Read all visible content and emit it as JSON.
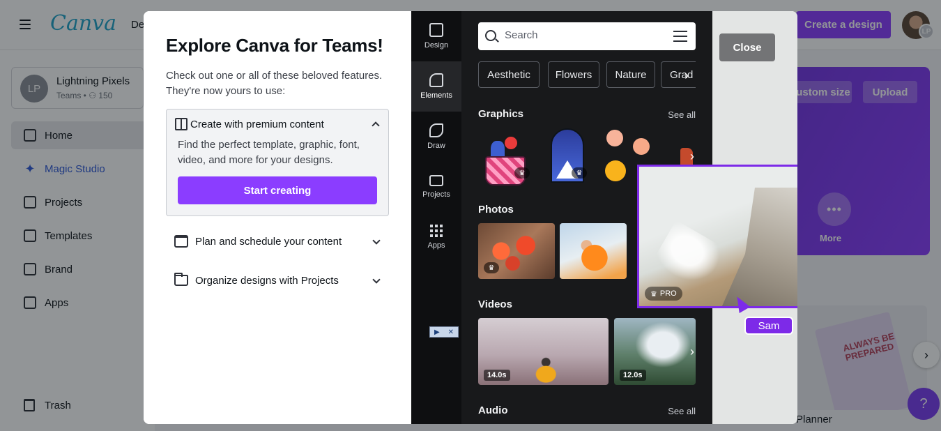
{
  "app": {
    "logo": "Canva",
    "nav_partial": "De",
    "create_button": "Create a design",
    "avatar_badge": "LP"
  },
  "sidebar": {
    "team_initials": "LP",
    "team_name": "Lightning Pixels",
    "team_sub": "Teams • ⚇ 150",
    "items": [
      {
        "label": "Home",
        "icon": "home-icon"
      },
      {
        "label": "Magic Studio",
        "icon": "sparkle-icon"
      },
      {
        "label": "Projects",
        "icon": "folder-icon"
      },
      {
        "label": "Templates",
        "icon": "templates-icon"
      },
      {
        "label": "Brand",
        "icon": "brand-icon"
      },
      {
        "label": "Apps",
        "icon": "apps-icon"
      }
    ],
    "trash": "Trash"
  },
  "hero": {
    "custom_size": "ustom size",
    "upload": "Upload",
    "more": "More"
  },
  "background": {
    "card_title": "ALWAYS BE PREPARED",
    "planner": "Planner",
    "help": "?"
  },
  "modal": {
    "title": "Explore Canva for Teams!",
    "description": "Check out one or all of these beloved features. They're now yours to use:",
    "features": [
      {
        "label": "Create with premium content",
        "body": "Find the perfect template, graphic, font, video, and more for your designs.",
        "button": "Start creating",
        "expanded": true
      },
      {
        "label": "Plan and schedule your content",
        "expanded": false
      },
      {
        "label": "Organize designs with Projects",
        "expanded": false
      }
    ],
    "close": "Close"
  },
  "editor": {
    "rail": [
      {
        "label": "Design",
        "icon": "design-icon"
      },
      {
        "label": "Elements",
        "icon": "elements-icon",
        "active": true
      },
      {
        "label": "Draw",
        "icon": "draw-icon"
      },
      {
        "label": "Projects",
        "icon": "folder-icon"
      },
      {
        "label": "Apps",
        "icon": "apps-icon"
      }
    ],
    "search_placeholder": "Search",
    "chips": [
      "Aesthetic",
      "Flowers",
      "Nature",
      "Grad"
    ],
    "sections": {
      "graphics": "Graphics",
      "photos": "Photos",
      "videos": "Videos",
      "audio": "Audio",
      "see_all": "See all"
    },
    "video_durations": [
      "14.0s",
      "12.0s"
    ],
    "pro_badge": "PRO",
    "collaborator": "Sam"
  }
}
